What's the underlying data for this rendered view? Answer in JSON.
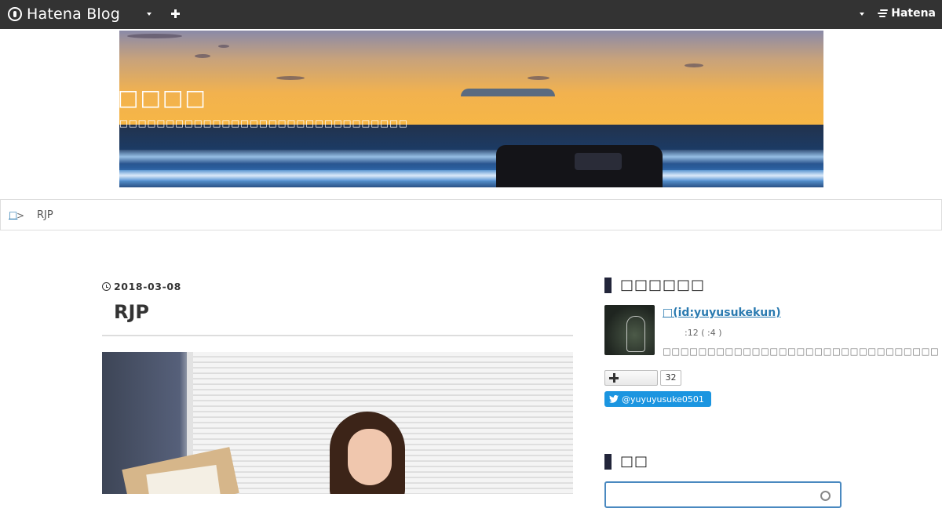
{
  "globalbar": {
    "logo_text": "Hatena Blog",
    "hatena_text": "Hatena"
  },
  "header": {
    "title": "□□□□",
    "description": "□□□□□□□□□□□□□□□□□□□□□□□□□□□□□□□"
  },
  "breadcrumb": {
    "home": "□",
    "separator": ">",
    "current": "RJP"
  },
  "entry": {
    "date": "2018-03-08",
    "title": "RJP"
  },
  "sidebar": {
    "profile_heading": "□□□□□□",
    "profile_name": "□(id:yuyusukekun)",
    "profile_stats": ":12 (       :4   )",
    "profile_desc": "□□□□□□□□□□□□□□□□□□□□□□□□□□□□□□□",
    "follow_count": "32",
    "twitter_handle": "@yuyuyusuke0501",
    "search_heading": "□□"
  },
  "colors": {
    "globalbar_bg": "#333333",
    "link": "#2a7ab0",
    "twitter": "#1b95e0",
    "heading_bar": "#22253a"
  }
}
